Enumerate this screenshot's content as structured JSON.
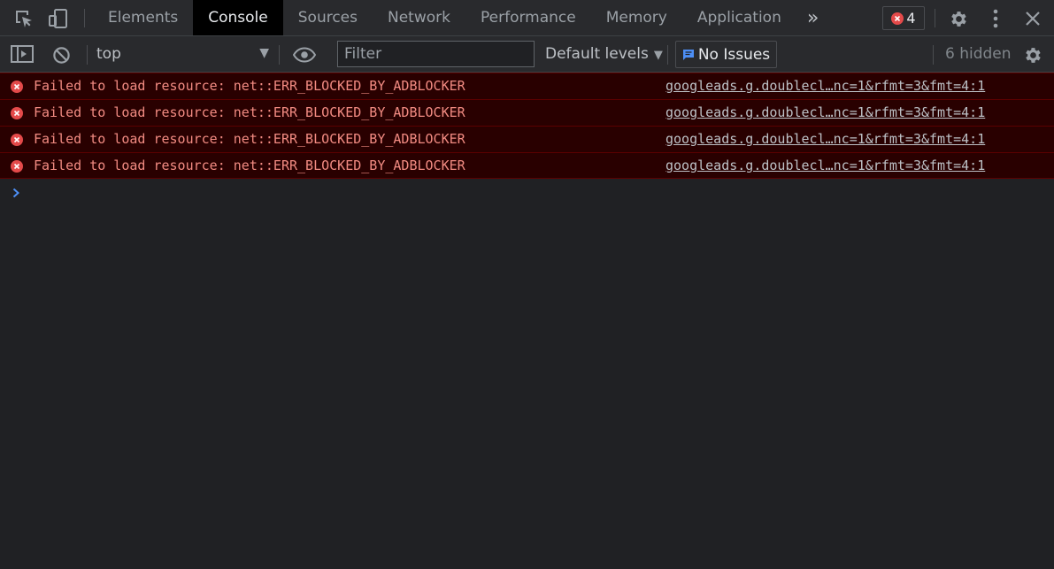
{
  "tabbar": {
    "tabs": [
      {
        "label": "Elements",
        "active": false
      },
      {
        "label": "Console",
        "active": true
      },
      {
        "label": "Sources",
        "active": false
      },
      {
        "label": "Network",
        "active": false
      },
      {
        "label": "Performance",
        "active": false
      },
      {
        "label": "Memory",
        "active": false
      },
      {
        "label": "Application",
        "active": false
      }
    ],
    "more_tabs_label": "»",
    "error_count": "4"
  },
  "toolbar": {
    "context_value": "top",
    "filter_placeholder": "Filter",
    "filter_value": "",
    "levels_label": "Default levels",
    "issues_label": "No Issues",
    "hidden_label": "6 hidden"
  },
  "messages": [
    {
      "text": "Failed to load resource: net::ERR_BLOCKED_BY_ADBLOCKER",
      "source": "googleads.g.doublecl…nc=1&rfmt=3&fmt=4:1"
    },
    {
      "text": "Failed to load resource: net::ERR_BLOCKED_BY_ADBLOCKER",
      "source": "googleads.g.doublecl…nc=1&rfmt=3&fmt=4:1"
    },
    {
      "text": "Failed to load resource: net::ERR_BLOCKED_BY_ADBLOCKER",
      "source": "googleads.g.doublecl…nc=1&rfmt=3&fmt=4:1"
    },
    {
      "text": "Failed to load resource: net::ERR_BLOCKED_BY_ADBLOCKER",
      "source": "googleads.g.doublecl…nc=1&rfmt=3&fmt=4:1"
    }
  ],
  "colors": {
    "error_text": "#f28b82",
    "error_bg": "#290000",
    "accent_blue": "#4d8ff6",
    "error_icon": "#e44a4a"
  }
}
